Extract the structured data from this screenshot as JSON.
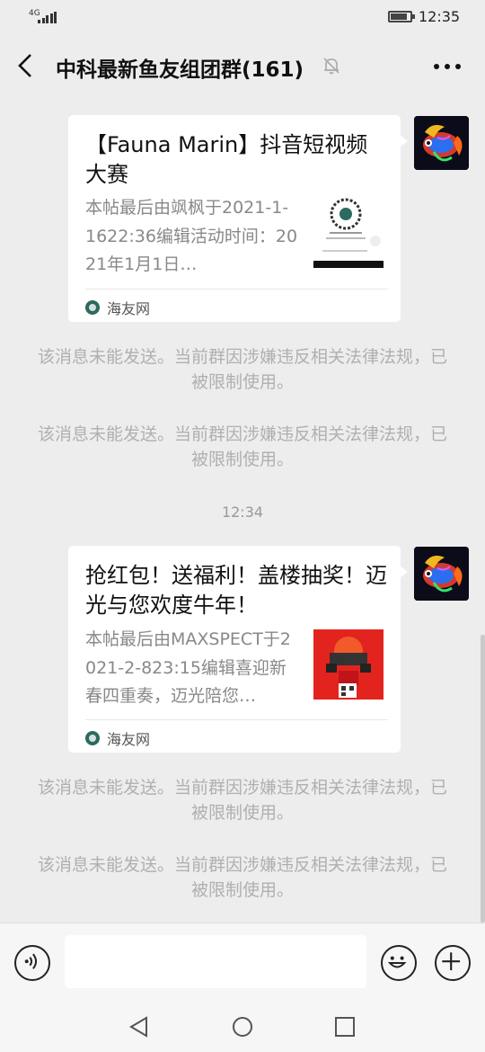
{
  "status_bar": {
    "network": "4G",
    "time": "12:35",
    "battery_level": 0.85
  },
  "header": {
    "title": "中科最新鱼友组团群(161)"
  },
  "messages": [
    {
      "title": "【Fauna Marin】抖音短视频大赛",
      "desc": "本帖最后由飒枫于2021-1-1622:36编辑活动时间：2021年1月1日…",
      "source": "海友网"
    },
    {
      "title": "抢红包！送福利！盖楼抽奖！迈光与您欢度牛年！",
      "desc": "本帖最后由MAXSPECT于2021-2-823:15编辑喜迎新春四重奏，迈光陪您…",
      "source": "海友网"
    }
  ],
  "system_notices": [
    "该消息未能发送。当前群因涉嫌违反相关法律法规，已被限制使用。",
    "该消息未能发送。当前群因涉嫌违反相关法律法规，已被限制使用。",
    "该消息未能发送。当前群因涉嫌违反相关法律法规，已被限制使用。",
    "该消息未能发送。当前群因涉嫌违反相关法律法规，已被限制使用。"
  ],
  "timestamp": "12:34",
  "input": {
    "placeholder": ""
  },
  "colors": {
    "background": "#ededed",
    "card": "#ffffff",
    "notice_text": "#b0b0b0",
    "source_icon": "#2c6a5f"
  },
  "icons": {
    "back": "chevron-left-icon",
    "mute": "bell-off-icon",
    "more": "more-dots-icon",
    "voice": "voice-icon",
    "emoji": "emoji-icon",
    "plus": "plus-icon"
  }
}
